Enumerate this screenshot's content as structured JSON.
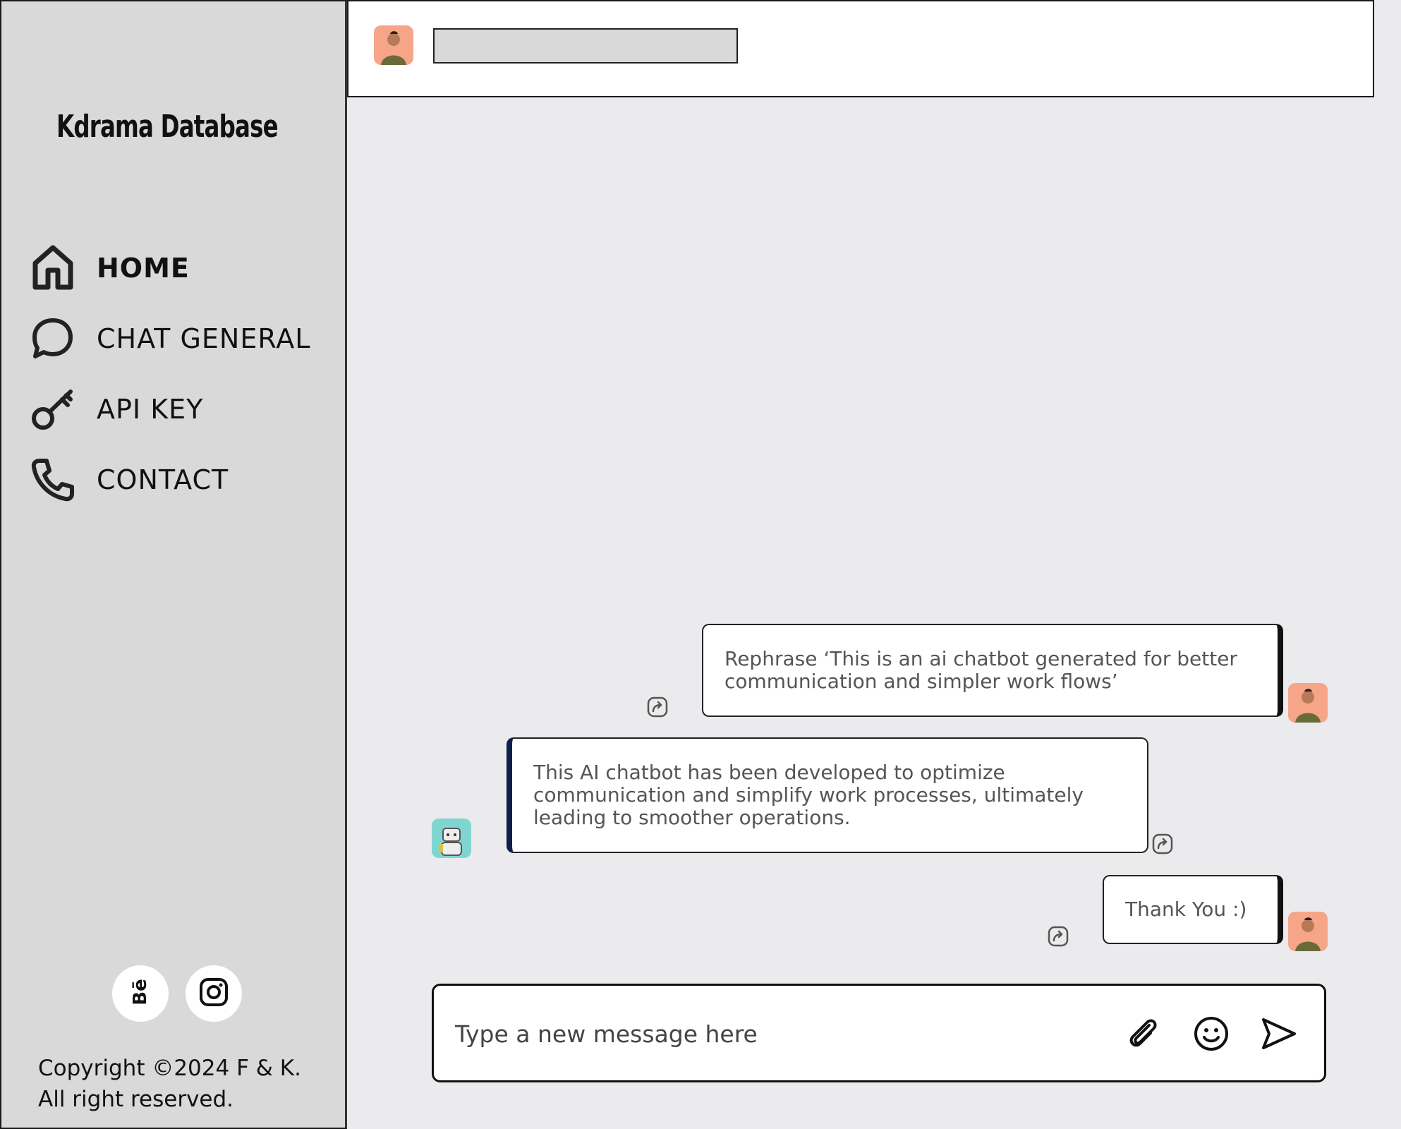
{
  "sidebar": {
    "brand": "Kdrama Database",
    "nav": [
      {
        "label": "HOME",
        "icon": "home-icon",
        "active": true
      },
      {
        "label": "CHAT  GENERAL",
        "icon": "chat-bubble-icon"
      },
      {
        "label": "API KEY",
        "icon": "key-icon"
      },
      {
        "label": "CONTACT",
        "icon": "phone-icon"
      }
    ],
    "social": [
      {
        "icon": "behance-icon"
      },
      {
        "icon": "instagram-icon"
      }
    ],
    "copyright": "Copyright ©2024 F & K. All right reserved."
  },
  "header": {
    "avatar": "user-avatar",
    "title_placeholder": ""
  },
  "messages": [
    {
      "from": "user",
      "text": "Rephrase ‘This is an ai chatbot generated for better communication and simpler work flows’"
    },
    {
      "from": "bot",
      "text": "This AI chatbot has been developed to optimize communication and simplify work processes, ultimately leading to smoother operations."
    },
    {
      "from": "user",
      "text": "Thank You :)"
    }
  ],
  "composer": {
    "placeholder": "Type a new message here",
    "buttons": [
      "paperclip-icon",
      "smiley-icon",
      "send-icon"
    ]
  },
  "colors": {
    "sidebar_bg": "#d9d9d9",
    "main_bg": "#ebebed",
    "avatar_bg": "#f6a588",
    "bot_avatar_bg": "#7fd6d0",
    "bot_accent": "#0f1f4a"
  }
}
